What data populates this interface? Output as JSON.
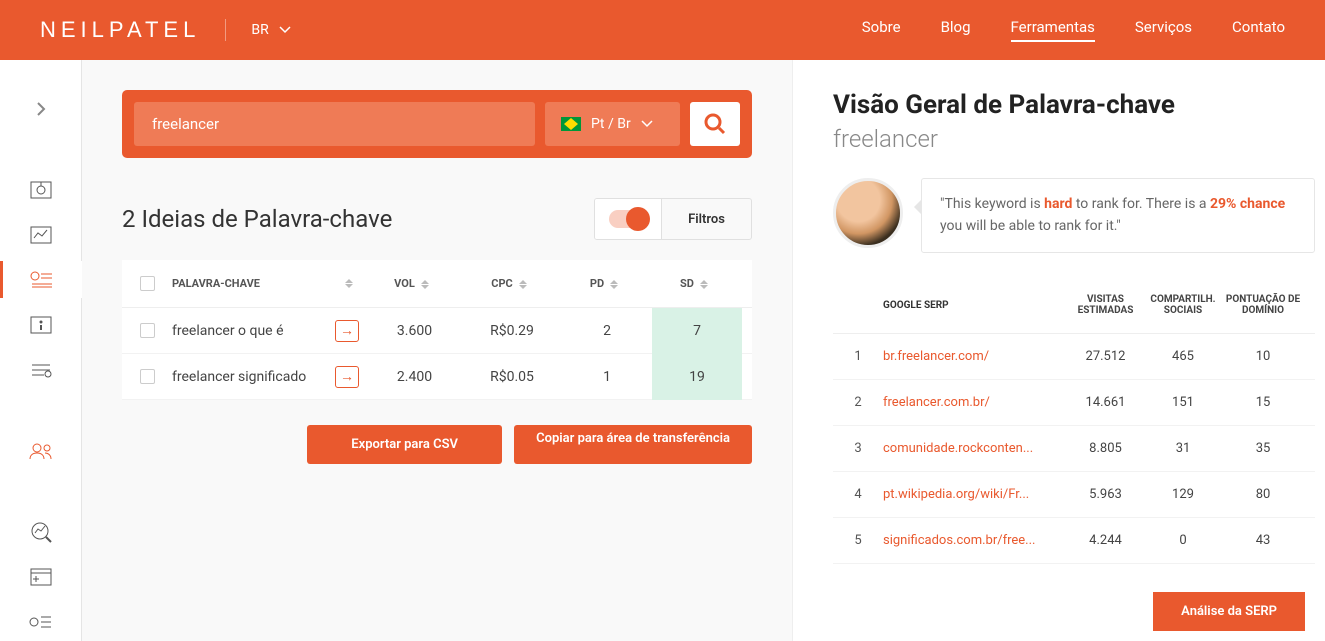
{
  "header": {
    "logo": "NEILPATEL",
    "locale": "BR",
    "nav": {
      "about": "Sobre",
      "blog": "Blog",
      "tools": "Ferramentas",
      "services": "Serviços",
      "contact": "Contato"
    }
  },
  "search": {
    "value": "freelancer",
    "locale_label": "Pt / Br"
  },
  "ideas": {
    "title": "2 Ideias de Palavra-chave",
    "filters_label": "Filtros",
    "columns": {
      "kw": "PALAVRA-CHAVE",
      "vol": "VOL",
      "cpc": "CPC",
      "pd": "PD",
      "sd": "SD"
    },
    "rows": [
      {
        "kw": "freelancer o que é",
        "vol": "3.600",
        "cpc": "R$0.29",
        "pd": "2",
        "sd": "7"
      },
      {
        "kw": "freelancer significado",
        "vol": "2.400",
        "cpc": "R$0.05",
        "pd": "1",
        "sd": "19"
      }
    ],
    "export_csv": "Exportar para CSV",
    "copy": "Copiar para área de transferência"
  },
  "overview": {
    "title": "Visão Geral de Palavra-chave",
    "keyword": "freelancer",
    "tip": {
      "pre": "\"This keyword is ",
      "hard": "hard",
      "mid": " to rank for. There is a ",
      "chance": "29% chance",
      "post": " you will be able to rank for it.\""
    },
    "columns": {
      "serp": "GOOGLE SERP",
      "visits": "VISITAS ESTIMADAS",
      "social": "COMPARTILH. SOCIAIS",
      "domain": "PONTUAÇÃO DE DOMÍNIO"
    },
    "rows": [
      {
        "rank": "1",
        "url": "br.freelancer.com/",
        "visits": "27.512",
        "social": "465",
        "dom": "10"
      },
      {
        "rank": "2",
        "url": "freelancer.com.br/",
        "visits": "14.661",
        "social": "151",
        "dom": "15"
      },
      {
        "rank": "3",
        "url": "comunidade.rockconten...",
        "visits": "8.805",
        "social": "31",
        "dom": "35"
      },
      {
        "rank": "4",
        "url": "pt.wikipedia.org/wiki/Fr...",
        "visits": "5.963",
        "social": "129",
        "dom": "80"
      },
      {
        "rank": "5",
        "url": "significados.com.br/free...",
        "visits": "4.244",
        "social": "0",
        "dom": "43"
      }
    ],
    "serp_btn": "Análise da SERP"
  }
}
